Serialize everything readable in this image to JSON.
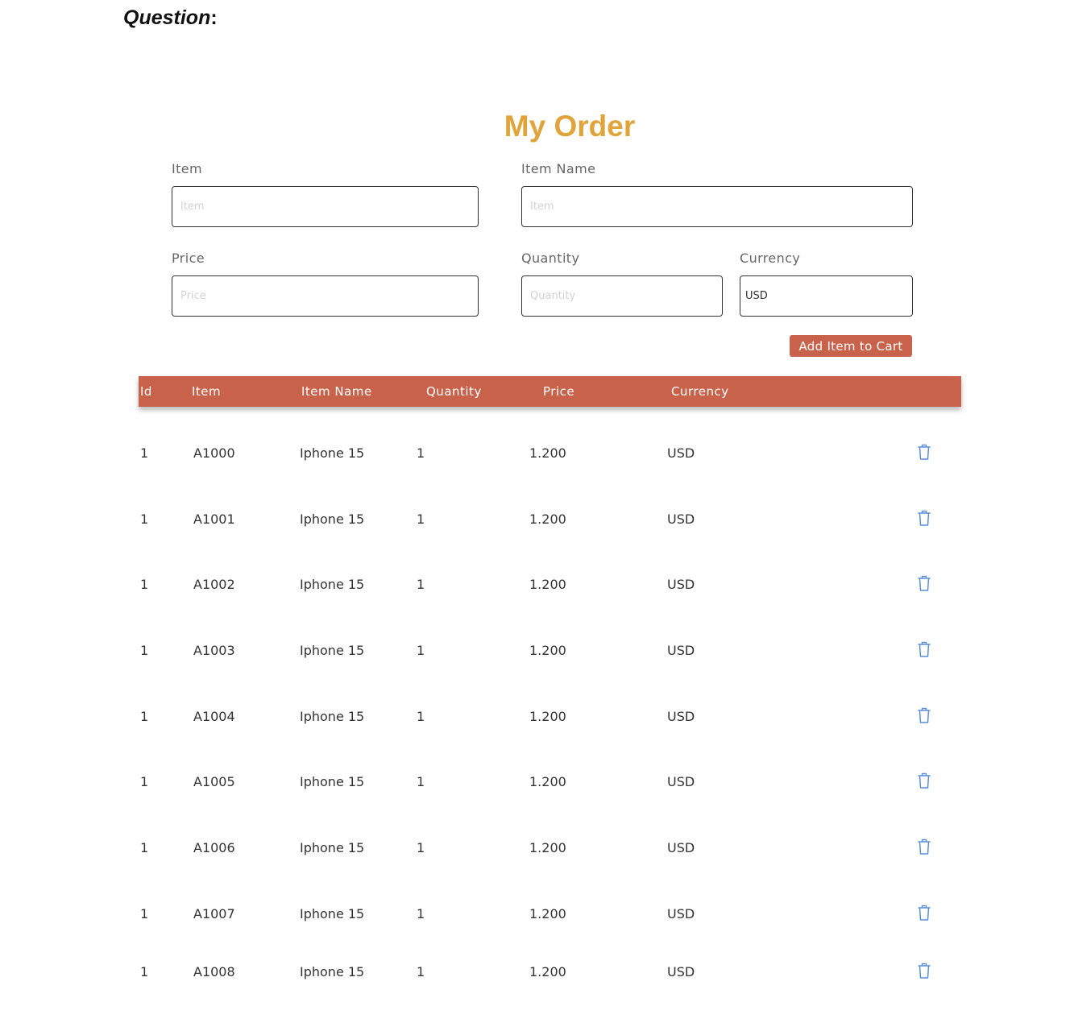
{
  "question": {
    "label": "Question",
    "suffix": ":"
  },
  "title": "My Order",
  "form": {
    "item": {
      "label": "Item",
      "placeholder": "Item",
      "value": ""
    },
    "item_name": {
      "label": "Item Name",
      "placeholder": "Item",
      "value": ""
    },
    "price": {
      "label": "Price",
      "placeholder": "Price",
      "value": ""
    },
    "quantity": {
      "label": "Quantity",
      "placeholder": "Quantity",
      "value": ""
    },
    "currency": {
      "label": "Currency",
      "value": "USD"
    },
    "add_button_label": "Add Item to Cart"
  },
  "table": {
    "headers": [
      "Id",
      "Item",
      "Item Name",
      "Quantity",
      "Price",
      "Currency"
    ],
    "rows": [
      {
        "id": "1",
        "item": "A1000",
        "item_name": "Iphone 15",
        "quantity": "1",
        "price": "1.200",
        "currency": "USD"
      },
      {
        "id": "1",
        "item": "A1001",
        "item_name": "Iphone 15",
        "quantity": "1",
        "price": "1.200",
        "currency": "USD"
      },
      {
        "id": "1",
        "item": "A1002",
        "item_name": "Iphone 15",
        "quantity": "1",
        "price": "1.200",
        "currency": "USD"
      },
      {
        "id": "1",
        "item": "A1003",
        "item_name": "Iphone 15",
        "quantity": "1",
        "price": "1.200",
        "currency": "USD"
      },
      {
        "id": "1",
        "item": "A1004",
        "item_name": "Iphone 15",
        "quantity": "1",
        "price": "1.200",
        "currency": "USD"
      },
      {
        "id": "1",
        "item": "A1005",
        "item_name": "Iphone 15",
        "quantity": "1",
        "price": "1.200",
        "currency": "USD"
      },
      {
        "id": "1",
        "item": "A1006",
        "item_name": "Iphone 15",
        "quantity": "1",
        "price": "1.200",
        "currency": "USD"
      },
      {
        "id": "1",
        "item": "A1007",
        "item_name": "Iphone 15",
        "quantity": "1",
        "price": "1.200",
        "currency": "USD"
      },
      {
        "id": "1",
        "item": "A1008",
        "item_name": "Iphone 15",
        "quantity": "1",
        "price": "1.200",
        "currency": "USD"
      }
    ],
    "row_action_icon": "trash-icon"
  },
  "colors": {
    "title": "#e0a43a",
    "accent": "#c8624b",
    "trash_icon": "#5b8fd6"
  }
}
